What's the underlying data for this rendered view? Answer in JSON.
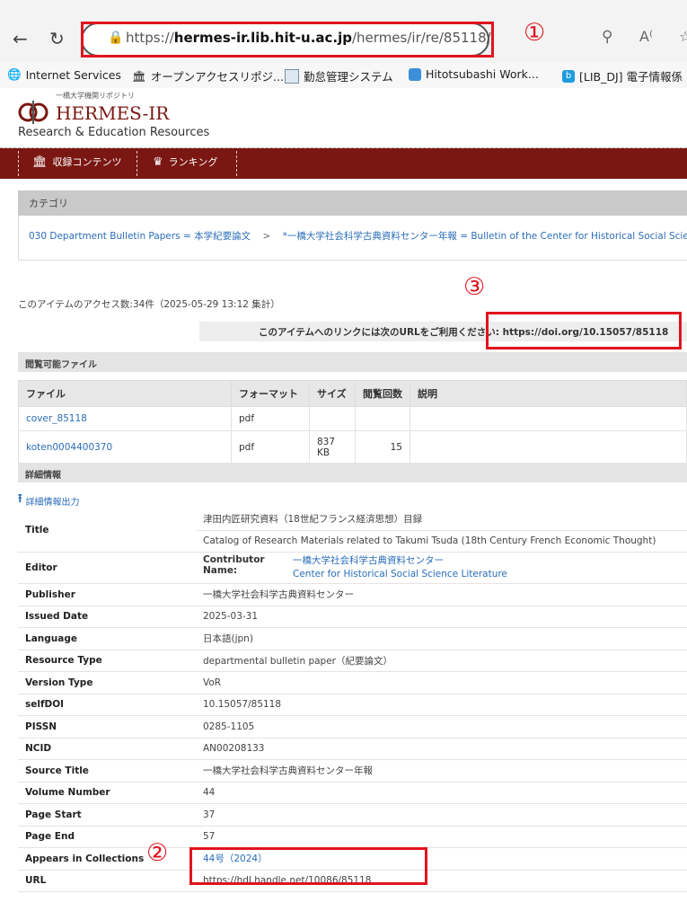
{
  "browser": {
    "url_prefix": "https://",
    "url_host": "hermes-ir.lib.hit-u.ac.jp",
    "url_path": "/hermes/ir/re/85118/",
    "bookmarks": [
      "Internet Services",
      "オープンアクセスリポジ...",
      "勤怠管理システム",
      "Hitotsubashi Work...",
      "[LIB_DJ] 電子情報係"
    ]
  },
  "site": {
    "logo_sub": "一橋大学機関リポジトリ",
    "logo_title": "HERMES-IR",
    "tagline": "Research & Education Resources",
    "nav": [
      "収録コンテンツ",
      "ランキング"
    ]
  },
  "category": {
    "header": "カテゴリ",
    "crumb1": "030 Department Bulletin Papers = 本学紀要論文",
    "separator": ">",
    "crumb2": "*一橋大学社会科学古典資料センター年報 = Bulletin of the Center for Historical Social Science"
  },
  "access_text": "このアイテムのアクセス数:34件（2025-05-29 13:12 集計）",
  "doi_notice": "このアイテムへのリンクには次のURLをご利用ください: https://doi.org/10.15057/85118",
  "files_section": "閲覧可能ファイル",
  "files_table": {
    "headers": [
      "ファイル",
      "フォーマット",
      "サイズ",
      "閲覧回数",
      "説明"
    ],
    "rows": [
      [
        "cover_85118",
        "pdf",
        "",
        "",
        ""
      ],
      [
        "koten0004400370",
        "pdf",
        "837 KB",
        "15",
        ""
      ]
    ]
  },
  "detail_section": "詳細情報",
  "export_label": "詳細情報出力",
  "details": {
    "title_label": "Title",
    "title_ja": "津田内匠研究資料（18世紀フランス経済思想）目録",
    "title_en": "Catalog of Research Materials related to Takumi Tsuda (18th Century French Economic Thought)",
    "editor_label": "Editor",
    "contributor_label": "Contributor Name:",
    "contributor_ja": "一橋大学社会科学古典資料センター",
    "contributor_en": "Center for Historical Social Science Literature",
    "rows": [
      [
        "Publisher",
        "一橋大学社会科学古典資料センター"
      ],
      [
        "Issued Date",
        "2025-03-31"
      ],
      [
        "Language",
        "日本語(jpn)"
      ],
      [
        "Resource Type",
        "departmental bulletin paper（紀要論文）"
      ],
      [
        "Version Type",
        "VoR"
      ],
      [
        "selfDOI",
        "10.15057/85118"
      ],
      [
        "PISSN",
        "0285-1105"
      ],
      [
        "NCID",
        "AN00208133"
      ],
      [
        "Source Title",
        "一橋大学社会科学古典資料センター年報"
      ],
      [
        "Volume Number",
        "44"
      ],
      [
        "Page Start",
        "37"
      ],
      [
        "Page End",
        "57"
      ],
      [
        "Appears in Collections",
        "44号（2024）"
      ],
      [
        "URL",
        "https://hdl.handle.net/10086/85118"
      ]
    ]
  },
  "annotations": [
    "①",
    "②",
    "③"
  ],
  "colors": {
    "nav_bg": "#7a1712",
    "link": "#2a6db8",
    "highlight": "#e0141e"
  }
}
